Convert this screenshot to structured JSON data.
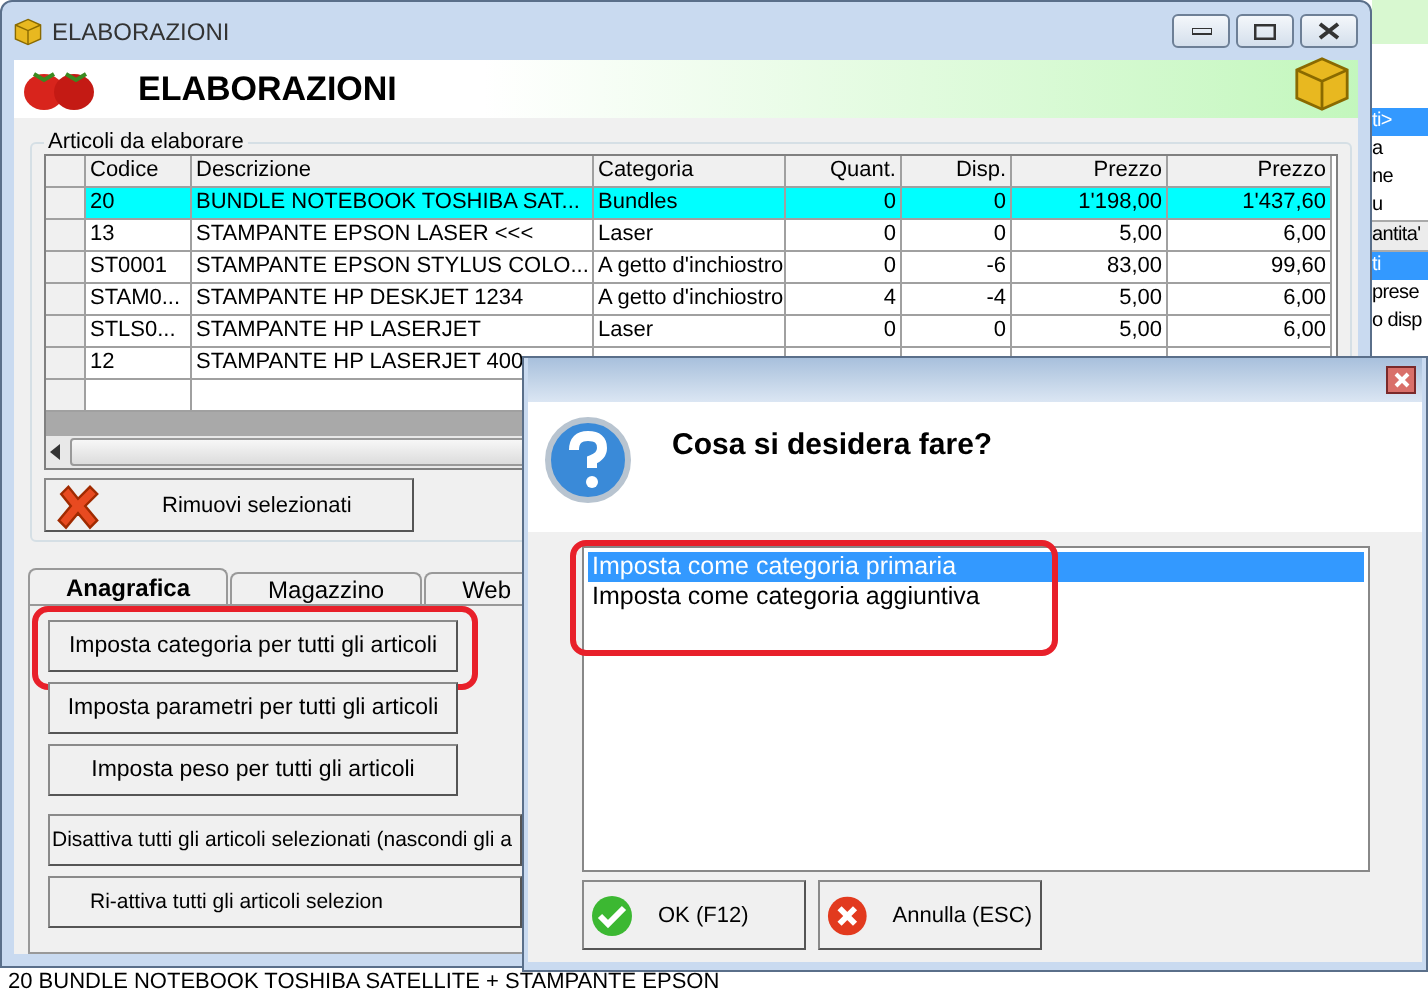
{
  "window": {
    "title": "ELABORAZIONI",
    "heading": "ELABORAZIONI"
  },
  "articles": {
    "legend": "Articoli da elaborare",
    "columns": [
      "Codice",
      "Descrizione",
      "Categoria",
      "Quant.",
      "Disp.",
      "Prezzo",
      "Prezzo"
    ],
    "rows": [
      {
        "cells": [
          "20",
          "BUNDLE NOTEBOOK TOSHIBA SAT...",
          "Bundles",
          "0",
          "0",
          "1'198,00",
          "1'437,60"
        ],
        "selected": true
      },
      {
        "cells": [
          "13",
          "STAMPANTE EPSON LASER <<<",
          "Laser",
          "0",
          "0",
          "5,00",
          "6,00"
        ],
        "selected": false
      },
      {
        "cells": [
          "ST0001",
          "STAMPANTE EPSON STYLUS COLO...",
          "A getto d'inchiostro",
          "0",
          "-6",
          "83,00",
          "99,60"
        ],
        "selected": false
      },
      {
        "cells": [
          "STAM0...",
          "STAMPANTE HP DESKJET 1234",
          "A getto d'inchiostro",
          "4",
          "-4",
          "5,00",
          "6,00"
        ],
        "selected": false
      },
      {
        "cells": [
          "STLS0...",
          "STAMPANTE HP LASERJET",
          "Laser",
          "0",
          "0",
          "5,00",
          "6,00"
        ],
        "selected": false
      },
      {
        "cells": [
          "12",
          "STAMPANTE HP LASERJET 400"
        ],
        "selected": false
      }
    ]
  },
  "remove_button": "Rimuovi selezionati",
  "tabs": [
    {
      "label": "Anagrafica",
      "selected": true
    },
    {
      "label": "Magazzino",
      "selected": false
    },
    {
      "label": "Web",
      "selected": false
    }
  ],
  "actions": [
    {
      "label": "Imposta categoria per tutti gli articoli",
      "annotated": true
    },
    {
      "label": "Imposta parametri per tutti gli articoli",
      "annotated": false
    },
    {
      "label": "Imposta peso per tutti gli articoli",
      "annotated": false
    },
    {
      "label": "Disattiva tutti gli articoli selezionati (nascondi gli a",
      "annotated": false
    },
    {
      "label": "Ri-attiva tutti gli articoli selezion",
      "annotated": false
    }
  ],
  "dialog": {
    "question": "Cosa si desidera fare?",
    "options_annotated": true,
    "options": [
      {
        "label": "Imposta come categoria primaria",
        "selected": true
      },
      {
        "label": "Imposta come categoria aggiuntiva",
        "selected": false
      }
    ],
    "buttons": [
      {
        "kind": "ok",
        "label": "OK (F12)"
      },
      {
        "kind": "cancel",
        "label": "Annulla (ESC)"
      }
    ]
  },
  "background_window": {
    "fragments": [
      {
        "kind": "item",
        "text": "ti>",
        "selected": true
      },
      {
        "kind": "item",
        "text": "a",
        "selected": false
      },
      {
        "kind": "item",
        "text": "ne",
        "selected": false
      },
      {
        "kind": "item",
        "text": "u",
        "selected": false
      },
      {
        "kind": "header",
        "text": "antita'",
        "selected": false
      },
      {
        "kind": "item",
        "text": "ti",
        "selected": true
      },
      {
        "kind": "item",
        "text": "prese",
        "selected": false
      },
      {
        "kind": "item",
        "text": "o disp",
        "selected": false
      }
    ],
    "footer": "20 BUNDLE NOTEBOOK TOSHIBA SATELLITE + STAMPANTE EPSON"
  }
}
